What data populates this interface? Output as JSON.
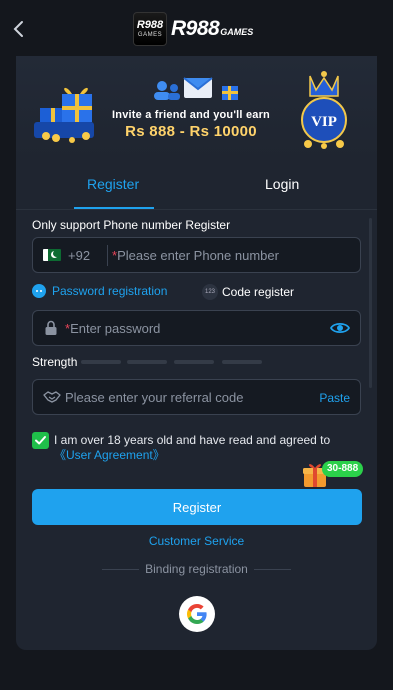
{
  "header": {
    "logo_badge_top": "R988",
    "logo_badge_bottom": "GAMES",
    "logo_text": "R988",
    "logo_sub": "GAMES"
  },
  "banner": {
    "invite_text": "Invite a friend and you'll earn",
    "reward_range": "Rs 888 - Rs 10000"
  },
  "tabs": [
    {
      "label": "Register",
      "active": true
    },
    {
      "label": "Login",
      "active": false
    }
  ],
  "form": {
    "support_text": "Only support Phone number Register",
    "country_code": "+92",
    "phone_placeholder": "Please enter Phone number",
    "required_mark": "*",
    "options": {
      "password_registration": "Password registration",
      "code_register": "Code register",
      "code_icon_text": "123"
    },
    "password_placeholder": "Enter password",
    "strength_label": "Strength",
    "referral_placeholder": "Please enter your referral code",
    "paste_label": "Paste",
    "agreement_text": "I am over 18 years old and have read and agreed to ",
    "agreement_link": "《User Agreement》",
    "agreement_checked": true
  },
  "gift_badge": "30-888",
  "actions": {
    "register_label": "Register",
    "customer_service": "Customer Service",
    "binding_label": "Binding registration"
  },
  "colors": {
    "accent": "#1fa2ee",
    "check": "#1fbf4a",
    "gold": "#ffd36b",
    "panel": "#1f2530",
    "background": "#14171d"
  }
}
